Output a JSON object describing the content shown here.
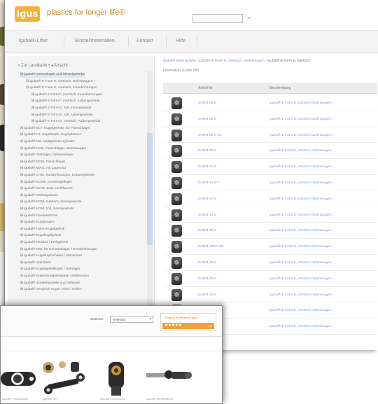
{
  "header": {
    "logo_text": "igus",
    "tagline": "plastics for longer life®",
    "search_go": "»"
  },
  "nav": {
    "items": [
      "igubal® Lifter",
      "Einstellmaterialien",
      "Kontakt",
      "Hilfe"
    ]
  },
  "sidebar": {
    "heading": "» Zur Landkarte • ◂ Ansicht",
    "items": [
      {
        "label": "⊟ igubal® Gelenkköpfe und Winkelgelenke",
        "indent": 1
      },
      {
        "label": "⊟ igubal® E Form E, metrisch, Gelenkaugen",
        "indent": 2
      },
      {
        "label": "⊟ igubal® E Form E, metrisch, Innenbohrungen",
        "indent": 2
      },
      {
        "label": "⊞ igubal® E Form F, metrisch, Innenbohrungen",
        "indent": 3
      },
      {
        "label": "⊞ igubal® E Form F, metrisch, Außengewinde",
        "indent": 3
      },
      {
        "label": "⊞ igubal® E Form E, zoll, Innengewinde",
        "indent": 3
      },
      {
        "label": "⊞ igubal® E Form E, zoll, Außengewinde",
        "indent": 3
      },
      {
        "label": "⊞ igubal® E Form E, metrisch, Außengewinde",
        "indent": 3
      },
      {
        "label": "⊞ igubal® ELF, Kugelgelenke mit Flanschlager",
        "indent": 1
      },
      {
        "label": "⊞ igubal® KT, Kugelköpfe, Kugelpfannen",
        "indent": 1
      },
      {
        "label": "⊞ igubal® KB, Axialgelenke Zylinder",
        "indent": 1
      },
      {
        "label": "⊞ igubal® KGS, Flanschlager, Gelenkaugen",
        "indent": 1
      },
      {
        "label": "⊞ igubal® Stehlager, Gehäuselager",
        "indent": 1
      },
      {
        "label": "⊞ igubal® EGM, Flanschlager",
        "indent": 1
      },
      {
        "label": "⊞ igubal® WAG, mit Lagerung",
        "indent": 1
      },
      {
        "label": "⊞ igubal® GTM, Sonderlösungen, Doppelgelenke",
        "indent": 1
      },
      {
        "label": "⊞ igubal® EGMF, Druckkugellager",
        "indent": 1
      },
      {
        "label": "⊞ igubal® WAM, Zwei-Lochflansch",
        "indent": 1
      },
      {
        "label": "⊞ igubal® Winkelgelenke",
        "indent": 1
      },
      {
        "label": "⊞ igubal® KGM, metrisch, Innengewinde",
        "indent": 1
      },
      {
        "label": "⊞ igubal® KGM, zoll, Innengewinde",
        "indent": 1
      },
      {
        "label": "⊞ igubal® Pendelstützen",
        "indent": 1
      },
      {
        "label": "⊞ igubal® Kupplungen",
        "indent": 1
      },
      {
        "label": "⊞ igubal® Hebel Kugelgelenk",
        "indent": 1
      },
      {
        "label": "⊞ igubal® Kugelkopfgelenk",
        "indent": 1
      },
      {
        "label": "⊞ igubal® Flexibel / Drehgelenk",
        "indent": 1
      },
      {
        "label": "⊞ igubal® Bsp. für Gehäuselager / Sonderlösungen",
        "indent": 1
      },
      {
        "label": "⊞ igubal® Kugelkopfschalen / Stanzrohre",
        "indent": 1
      },
      {
        "label": "⊞ igubal® Stanzteile",
        "indent": 1
      },
      {
        "label": "⊞ igubal® Kugelgelenkköpfe / Stehlager",
        "indent": 1
      },
      {
        "label": "⊞ igubal® Anwendungsbeispiele / Referenzen",
        "indent": 1
      },
      {
        "label": "⊞ igubal® Sonderbauteile und Gehäuse",
        "indent": 1
      },
      {
        "label": "⊞ igubal® Vergleich Kugel / Gleit / Rollen",
        "indent": 1
      }
    ]
  },
  "breadcrumb": {
    "links": [
      "igubal® Gelenkköpfe",
      "igubal® E Form E, metrisch, Gelenkaugen"
    ],
    "current": "igubal® E Form E, metrisch"
  },
  "info": "Information zu den 383",
  "table": {
    "headers": [
      "Artikel-Nr.",
      "Beschreibung"
    ],
    "rows": [
      {
        "num": "EGRM-05-S",
        "desc": "igubal® E Form E, metrisch Gelenkaugen"
      },
      {
        "num": "EGRM-06-S",
        "desc": "igubal® E Form E, metrisch Gelenkaugen"
      },
      {
        "num": "EGRM-06-S-1E",
        "desc": "igubal® E Form E, metrisch Gelenkaugen"
      },
      {
        "num": "EGRM-08-S",
        "desc": "igubal® E Form E, metrisch Gelenkaugen"
      },
      {
        "num": "EGRM-10-S",
        "desc": "igubal® E Form E, metrisch Gelenkaugen"
      },
      {
        "num": "EGRM-10-S-F",
        "desc": "igubal® E Form E, metrisch Gelenkaugen"
      },
      {
        "num": "EGRM-12-S",
        "desc": "igubal® E Form E, metrisch Gelenkaugen"
      },
      {
        "num": "EGRM-14-S",
        "desc": "igubal® E Form E, metrisch Gelenkaugen"
      },
      {
        "num": "EGRM-16-S",
        "desc": "igubal® E Form E, metrisch Gelenkaugen"
      },
      {
        "num": "EGRM-16RF-SM",
        "desc": "igubal® E Form E, metrisch Gelenkaugen"
      },
      {
        "num": "EGRM-18-S",
        "desc": "igubal® E Form E, metrisch Gelenkaugen"
      },
      {
        "num": "EGRM-20-S",
        "desc": "igubal® E Form E, metrisch Gelenkaugen"
      },
      {
        "num": "EGRM-22-S",
        "desc": "igubal® E Form E, metrisch Gelenkaugen"
      },
      {
        "num": "EGRM-25-S",
        "desc": "igubal® E Form E, metrisch Gelenkaugen"
      },
      {
        "num": "EGRM-30-S",
        "desc": "igubal® E Form E, metrisch Gelenkaugen"
      }
    ]
  },
  "front": {
    "sort_label": "Sortieren:",
    "sort_value": "Relevanz",
    "sort_caret": "▾",
    "rating_title": "Fragen & Bewertungen",
    "rating_stars": "★★★★★",
    "rating_value": "4,5",
    "products": [
      "igubal® Flanschlager",
      "igubal® Set",
      "igubal® Gelenkkopf",
      "igubal® Winkelgelenk"
    ]
  },
  "colors": {
    "brand": "#f2b33a",
    "link": "#7f9ccb",
    "accent_orange": "#f0a03e"
  }
}
